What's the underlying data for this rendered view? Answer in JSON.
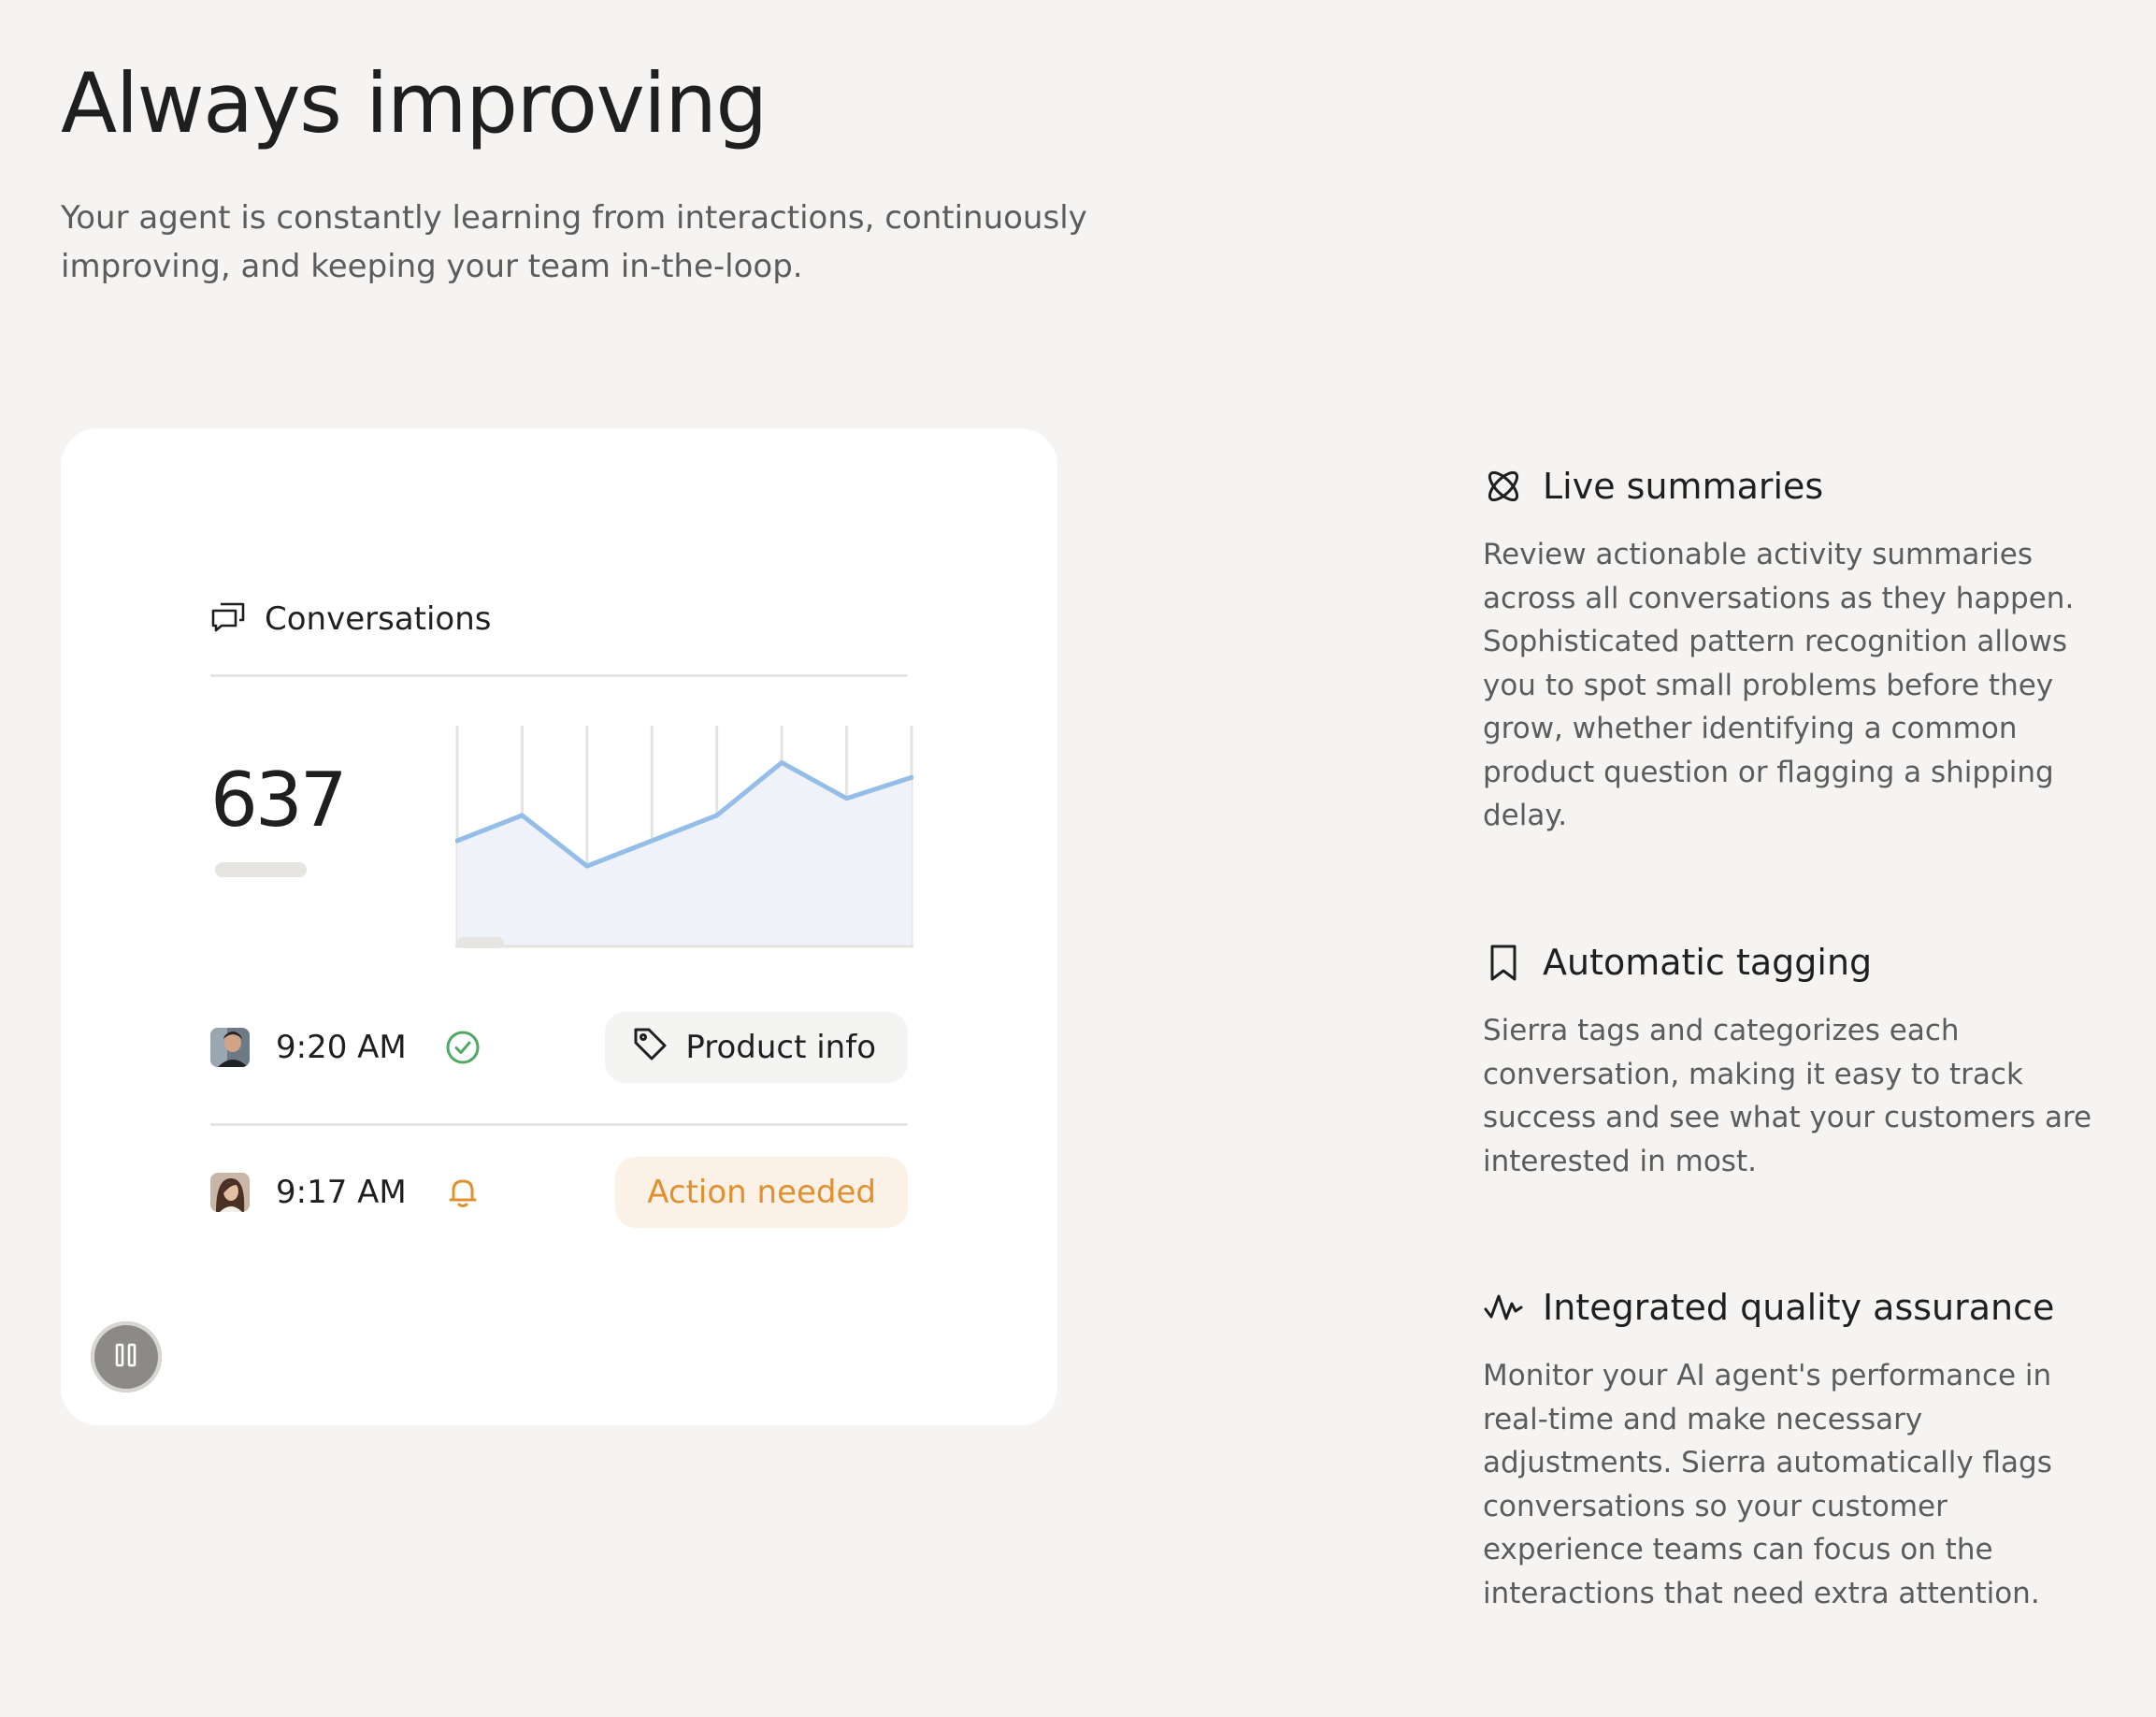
{
  "header": {
    "title": "Always improving",
    "subtitle": "Your agent is constantly learning from interactions, continuously improving, and keeping your team in-the-loop."
  },
  "card": {
    "section_label": "Conversations",
    "section_icon": "chat-bubbles-icon",
    "count": "637",
    "chart_data": {
      "type": "area",
      "x": [
        0,
        1,
        2,
        3,
        4,
        5,
        6,
        7
      ],
      "values": [
        50,
        62,
        38,
        50,
        62,
        87,
        70,
        80
      ],
      "ylim": [
        0,
        100
      ],
      "grid": true,
      "series_color": "#94bde8",
      "fill_color": "#eff3f9"
    },
    "rows": [
      {
        "time": "9:20 AM",
        "status_icon": "check-circle-icon",
        "status_color": "#4fa866",
        "tag_label": "Product info",
        "tag_icon": "price-tag-icon"
      },
      {
        "time": "9:17 AM",
        "status_icon": "bell-icon",
        "status_color": "#e0902f",
        "tag_label": "Action needed",
        "tag_color": "#e0902f"
      }
    ],
    "pause_icon": "pause-icon"
  },
  "features": [
    {
      "icon": "atom-icon",
      "title": "Live summaries",
      "description": "Review actionable activity summaries across all conversations as they happen. Sophisticated pattern recognition allows you to spot small problems before they grow, whether identifying a common product question or flagging a shipping delay."
    },
    {
      "icon": "bookmark-icon",
      "title": "Automatic tagging",
      "description": "Sierra tags and categorizes each conversation, making it easy to track success and see what your customers are interested in most."
    },
    {
      "icon": "activity-wave-icon",
      "title": "Integrated quality assurance",
      "description": "Monitor your AI agent's performance in real-time and make necessary adjustments. Sierra automatically flags conversations so your customer experience teams can focus on the interactions that need extra attention."
    }
  ]
}
